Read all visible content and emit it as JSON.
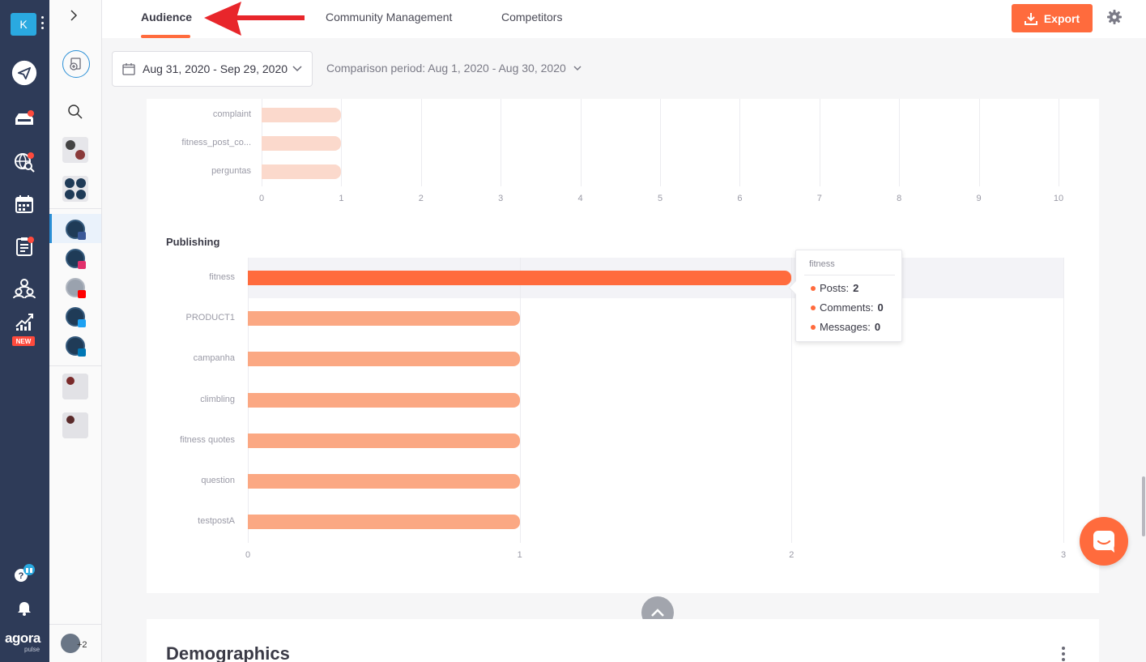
{
  "workspace": {
    "initial": "K"
  },
  "nav": {
    "new_badge": "NEW"
  },
  "brand": {
    "logo": "agora",
    "sub": "pulse"
  },
  "profiles": {
    "extra_count": "+2"
  },
  "tabs": [
    {
      "label": "Audience",
      "active": true
    },
    {
      "label": "Community Management",
      "active": false
    },
    {
      "label": "Competitors",
      "active": false
    }
  ],
  "toolbar": {
    "export_label": "Export"
  },
  "filters": {
    "date_range": "Aug 31, 2020 - Sep 29, 2020",
    "comparison": "Comparison period: Aug 1, 2020 - Aug 30, 2020"
  },
  "colors": {
    "accent": "#ff6b3d",
    "bar_light": "#fbd9cc",
    "bar_mid": "#fba883",
    "bar_dark": "#ff6b3d",
    "nav_bg": "#2e3b58"
  },
  "chart_data": [
    {
      "type": "bar",
      "orientation": "horizontal",
      "categories": [
        "complaint",
        "fitness_post_co...",
        "perguntas"
      ],
      "values": [
        1,
        1,
        1
      ],
      "xlim": [
        0,
        10
      ],
      "ticks": [
        "0",
        "1",
        "2",
        "3",
        "4",
        "5",
        "6",
        "7",
        "8",
        "9",
        "10"
      ]
    },
    {
      "type": "bar",
      "orientation": "horizontal",
      "title": "Publishing",
      "categories": [
        "fitness",
        "PRODUCT1",
        "campanha",
        "climbling",
        "fitness quotes",
        "question",
        "testpostA"
      ],
      "values": [
        2,
        1,
        1,
        1,
        1,
        1,
        1
      ],
      "xlim": [
        0,
        3
      ],
      "ticks": [
        "0",
        "1",
        "2",
        "3"
      ],
      "highlight_index": 0
    }
  ],
  "tooltip": {
    "title": "fitness",
    "rows": [
      {
        "label": "Posts:",
        "value": "2"
      },
      {
        "label": "Comments:",
        "value": "0"
      },
      {
        "label": "Messages:",
        "value": "0"
      }
    ]
  },
  "demographics": {
    "title": "Demographics"
  }
}
